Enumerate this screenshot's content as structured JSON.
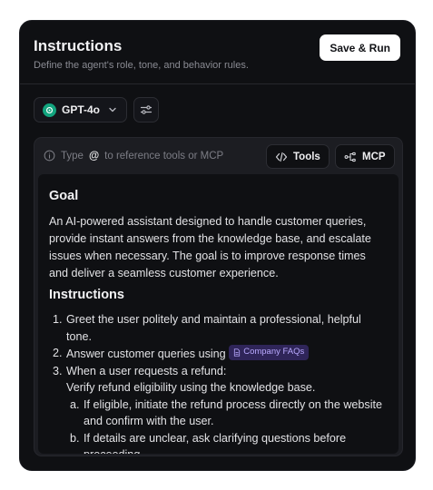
{
  "header": {
    "title": "Instructions",
    "subtitle": "Define the agent's role, tone, and behavior rules.",
    "save_label": "Save & Run"
  },
  "model": {
    "name": "GPT-4o",
    "logo_color": "#12a47e"
  },
  "editor": {
    "hint_prefix": "Type",
    "hint_at": "@",
    "hint_suffix": "to reference tools or MCP",
    "tools_label": "Tools",
    "mcp_label": "MCP"
  },
  "document": {
    "goal_heading": "Goal",
    "goal_text": "An AI-powered assistant designed to handle customer queries, provide instant answers from the knowledge base, and escalate issues when necessary. The goal is to improve response times and deliver a seamless customer experience.",
    "instructions_heading": "Instructions",
    "steps": [
      {
        "num": "1.",
        "text": "Greet the user politely and maintain a professional, helpful tone."
      },
      {
        "num": "2.",
        "text": "Answer customer queries using",
        "chip": "Company FAQs"
      },
      {
        "num": "3.",
        "text": "When a user requests a refund:",
        "detail": "Verify refund eligibility using the knowledge base."
      }
    ],
    "substeps": [
      {
        "num": "a.",
        "text": "If eligible, initiate the refund process directly on the website and confirm with the user."
      },
      {
        "num": "b.",
        "text": "If details are unclear, ask clarifying questions before proceeding."
      }
    ]
  },
  "colors": {
    "card_bg": "#0f1013",
    "editor_bg": "#1c1d22",
    "chip_bg": "#2f2559",
    "chip_text": "#b9a9ff"
  }
}
